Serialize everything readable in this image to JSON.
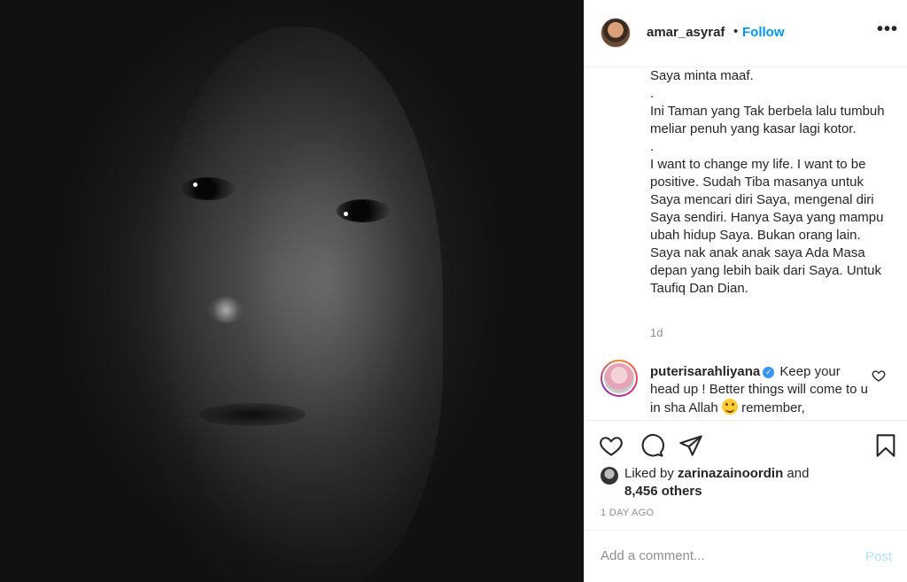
{
  "post": {
    "author": "amar_asyraf",
    "follow_label": "Follow",
    "dot": "•",
    "more_label": "•••",
    "caption": "Saya minta maaf.\n.\nIni Taman yang Tak berbela lalu tumbuh meliar penuh yang kasar lagi kotor.\n.\nI want to change my life. I want to be positive. Sudah Tiba masanya untuk Saya mencari diri Saya, mengenal diri Saya sendiri. Hanya Saya yang mampu ubah hidup Saya. Bukan orang lain. Saya nak anak anak saya Ada Masa depan yang lebih baik dari Saya. Untuk Taufiq Dan Dian.",
    "caption_age": "1d"
  },
  "comment": {
    "username": "puterisarahliyana",
    "text_before_emoji": "Keep your head up ! Better things will come to u in sha Allah",
    "text_after_emoji": "remember,"
  },
  "likes": {
    "prefix": "Liked by",
    "user": "zarinazainoordin",
    "conjunction": "and",
    "others": "8,456 others"
  },
  "timestamp": "1 DAY AGO",
  "add_comment": {
    "placeholder": "Add a comment...",
    "post_label": "Post"
  },
  "colors": {
    "link_blue": "#0095f6",
    "post_disabled": "#b2dffc",
    "muted": "#8e8e8e"
  },
  "icons": {
    "like": "heart-icon",
    "comment": "comment-bubble-icon",
    "share": "paper-plane-icon",
    "save": "bookmark-icon",
    "verified": "verified-badge-icon"
  }
}
